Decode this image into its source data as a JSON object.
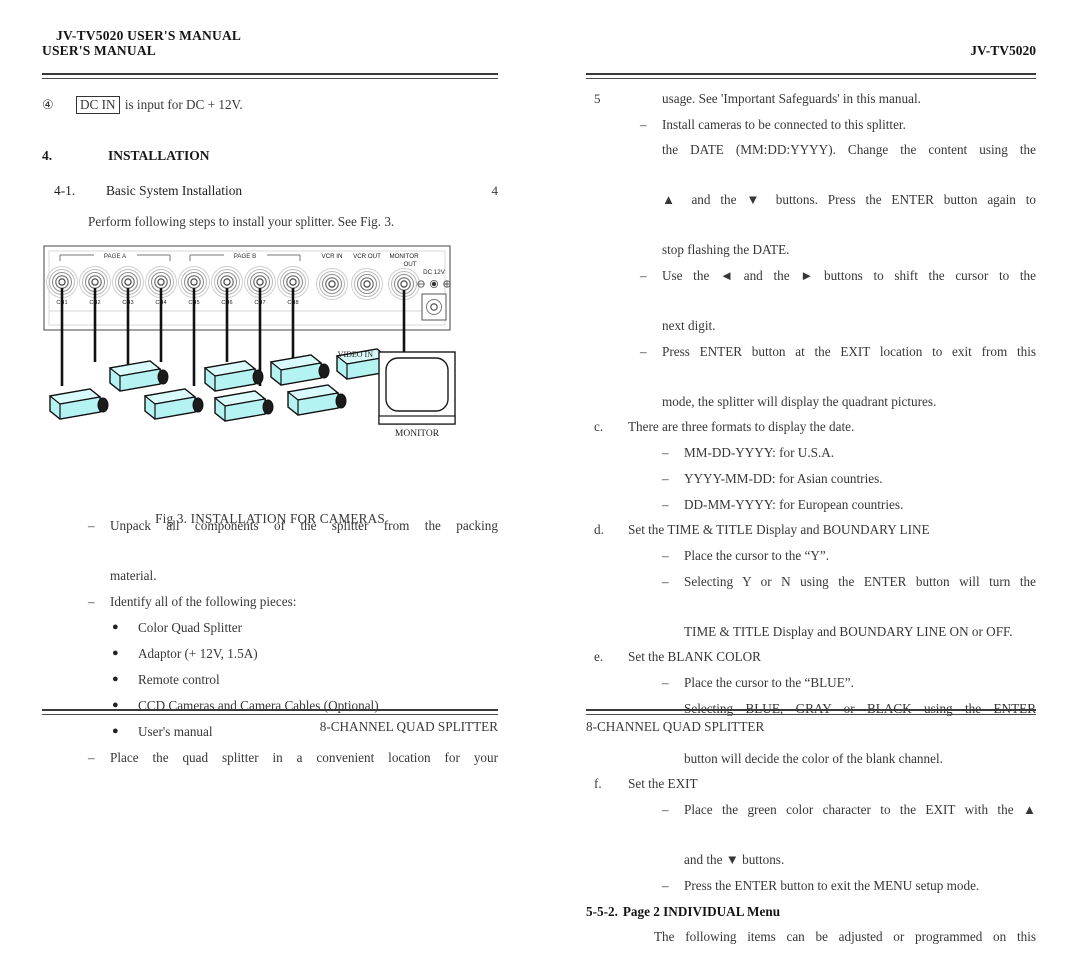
{
  "document": {
    "title": "JV-TV5020 USER'S MANUAL",
    "model": "JV-TV5020"
  },
  "left_page": {
    "header": {
      "line1": "JV-TV5020  USER'S  MANUAL",
      "line2": "USER'S MANUAL"
    },
    "numbered_item": {
      "marker": "④",
      "boxed_label": "DC IN",
      "text": "is input for DC + 12V."
    },
    "section": {
      "number": "4.",
      "title": "INSTALLATION"
    },
    "subsection": {
      "number": "4-1.",
      "title": "Basic System Installation",
      "page_marker": "4"
    },
    "intro_paragraph": "Perform following steps to install your splitter. See Fig. 3.",
    "figure": {
      "caption": "Fig 3. INSTALLATION FOR CAMERAS",
      "page_a_label": "PAGE A",
      "page_b_label": "PAGE B",
      "connector_labels": [
        "CH1",
        "CH2",
        "CH3",
        "CH4",
        "CH5",
        "CH6",
        "CH7",
        "CH8"
      ],
      "vcr_in_label": "VCR IN",
      "vcr_out_label": "VCR OUT",
      "monitor_out_label_line1": "MONITOR",
      "monitor_out_label_line2": "OUT",
      "dc_label": "DC 12V",
      "video_in_label": "VIDEO IN",
      "monitor_label": "MONITOR",
      "camera_color": "#b5f2f2",
      "camera_count": 8
    },
    "steps": [
      {
        "mark": "–",
        "lines": [
          "Unpack all components of the splitter from the packing",
          "material."
        ],
        "justify_first": true
      },
      {
        "mark": "–",
        "lines": [
          "Identify all of the following pieces:"
        ],
        "justify_first": false
      }
    ],
    "pieces": [
      "Color Quad Splitter",
      "Adaptor (+ 12V, 1.5A)",
      "Remote control",
      "CCD Cameras and Camera Cables (Optional)",
      "User's manual"
    ],
    "bullet_mark": "●",
    "last_step": {
      "mark": "–",
      "text": "Place the quad splitter in a convenient location for your"
    },
    "footer": "8-CHANNEL QUAD SPLITTER"
  },
  "right_page": {
    "header_right": "JV-TV5020",
    "page_number": "5",
    "continued_line": "usage. See 'Important Safeguards' in this manual.",
    "install_cameras_line": {
      "mark": "–",
      "text": "Install cameras to be connected to this splitter."
    },
    "date_block": {
      "line1": "the DATE (MM:DD:YYYY). Change the content using the",
      "line2_pre": "▲ and the ",
      "line2_arrow": "▼",
      "line2_post": " buttons. Press the ENTER button again to",
      "line3": "stop flashing the DATE."
    },
    "cursor_shift": {
      "mark": "–",
      "pre": "Use the ",
      "left_arrow": "◄",
      "mid": " and the ",
      "right_arrow": "►",
      "post": " buttons to shift the cursor to the",
      "line2": "next digit."
    },
    "exit_press": {
      "mark": "–",
      "line1": "Press ENTER button at the EXIT location to exit from this",
      "line2": "mode, the splitter will display the quadrant pictures."
    },
    "item_c": {
      "mark": "c.",
      "title": "There are three formats to display the date.",
      "formats": [
        "MM-DD-YYYY: for U.S.A.",
        "YYYY-MM-DD: for Asian countries.",
        "DD-MM-YYYY: for European countries."
      ]
    },
    "item_d": {
      "mark": "d.",
      "title": "Set the TIME & TITLE Display and BOUNDARY LINE",
      "subs": [
        {
          "lines": [
            "Place the cursor to the “Y”."
          ],
          "justify": false
        },
        {
          "lines": [
            "Selecting Y or N using the ENTER button will turn the",
            "TIME & TITLE Display and BOUNDARY LINE ON or OFF."
          ],
          "justify": true
        }
      ]
    },
    "item_e": {
      "mark": "e.",
      "title": "Set the BLANK COLOR",
      "subs": [
        {
          "lines": [
            "Place the cursor to the “BLUE”."
          ],
          "justify": false
        },
        {
          "lines": [
            "Selecting BLUE, GRAY or BLACK using the ENTER",
            "button will decide the color of the blank channel."
          ],
          "justify": true
        }
      ]
    },
    "item_f": {
      "mark": "f.",
      "title": "Set the EXIT",
      "sub1_pre": "Place the green color character to the EXIT with the ",
      "sub1_arrow_up": "▲",
      "sub1_line2_pre": "and  the ",
      "sub1_arrow_down": "▼",
      "sub1_line2_post": "  buttons.",
      "sub2": "Press the ENTER button to exit the MENU setup mode."
    },
    "subsection_552": {
      "number": "5-5-2.",
      "title": "Page 2 INDIVIDUAL Menu"
    },
    "trailing_paragraph": "The following items can be adjusted or programmed on this",
    "footer": "8-CHANNEL QUAD SPLITTER"
  },
  "dash_mark": "–"
}
